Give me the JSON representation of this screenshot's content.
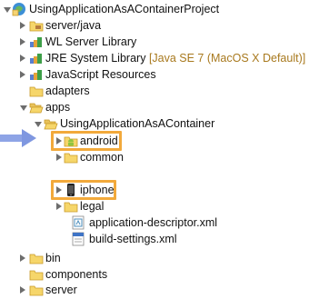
{
  "tree": {
    "project": "UsingApplicationAsAContainerProject",
    "server_java": "server/java",
    "wl_library": "WL Server Library",
    "jre_library": "JRE System Library",
    "jre_decoration": "[Java SE 7 (MacOS X Default)]",
    "js_resources": "JavaScript Resources",
    "adapters": "adapters",
    "apps": "apps",
    "app": "UsingApplicationAsAContainer",
    "android": "android",
    "common": "common",
    "iphone": "iphone",
    "legal": "legal",
    "app_descriptor": "application-descriptor.xml",
    "build_settings": "build-settings.xml",
    "bin": "bin",
    "components": "components",
    "server": "server"
  },
  "colors": {
    "highlight": "#f2a93b",
    "pointer_arrow": "#7f97e0",
    "folder": "#f6d66a",
    "decoration": "#a8791e"
  }
}
